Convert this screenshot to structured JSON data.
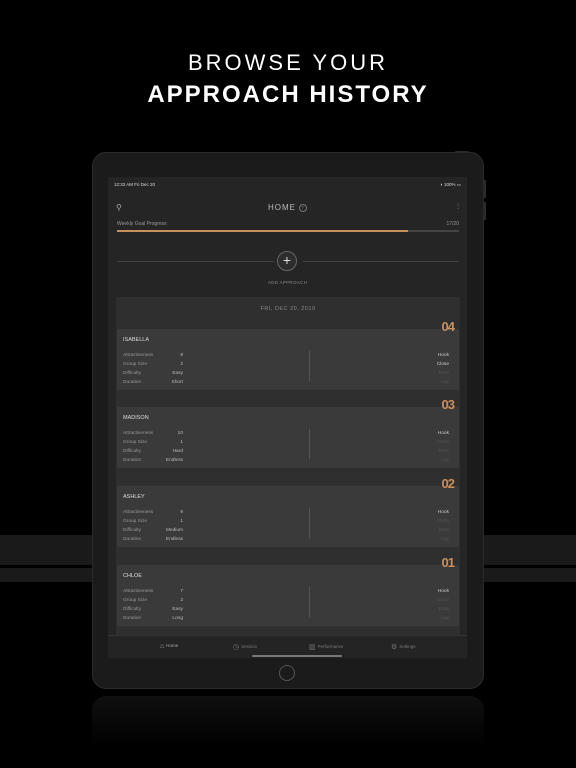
{
  "headline": {
    "line1": "BROWSE YOUR",
    "line2": "APPROACH HISTORY"
  },
  "status_bar": {
    "time_date": "12:33 AM   Fri Dec 20",
    "battery": "100%"
  },
  "header": {
    "title": "HOME",
    "help_icon": "?"
  },
  "goal": {
    "label": "Weekly Goal Progress",
    "count": "17/20",
    "progress_fraction": 0.85
  },
  "add_approach": {
    "symbol": "+",
    "label": "ADD APPROACH"
  },
  "history": {
    "date": "FRI, DEC 20, 2019",
    "stage_labels": [
      "Hook",
      "Close",
      "Date",
      "Lay"
    ],
    "field_labels": [
      "Attractiveness",
      "Group Size",
      "Difficulty",
      "Duration"
    ],
    "entries": [
      {
        "number": "04",
        "name": "ISABELLA",
        "values": [
          "8",
          "2",
          "Easy",
          "Short"
        ],
        "stages_on": [
          true,
          true,
          false,
          false
        ]
      },
      {
        "number": "03",
        "name": "MADISON",
        "values": [
          "10",
          "1",
          "Hard",
          "Endless"
        ],
        "stages_on": [
          true,
          false,
          false,
          false
        ]
      },
      {
        "number": "02",
        "name": "ASHLEY",
        "values": [
          "9",
          "1",
          "Medium",
          "Endless"
        ],
        "stages_on": [
          true,
          false,
          false,
          false
        ]
      },
      {
        "number": "01",
        "name": "CHLOE",
        "values": [
          "7",
          "2",
          "Easy",
          "Long"
        ],
        "stages_on": [
          true,
          false,
          false,
          false
        ]
      }
    ]
  },
  "tabs": [
    {
      "label": "Home",
      "icon": "home-icon",
      "glyph": "⌂"
    },
    {
      "label": "Session",
      "icon": "clock-icon",
      "glyph": "◷"
    },
    {
      "label": "Performance",
      "icon": "chart-icon",
      "glyph": "▥"
    },
    {
      "label": "Settings",
      "icon": "gear-icon",
      "glyph": "⚙"
    }
  ]
}
